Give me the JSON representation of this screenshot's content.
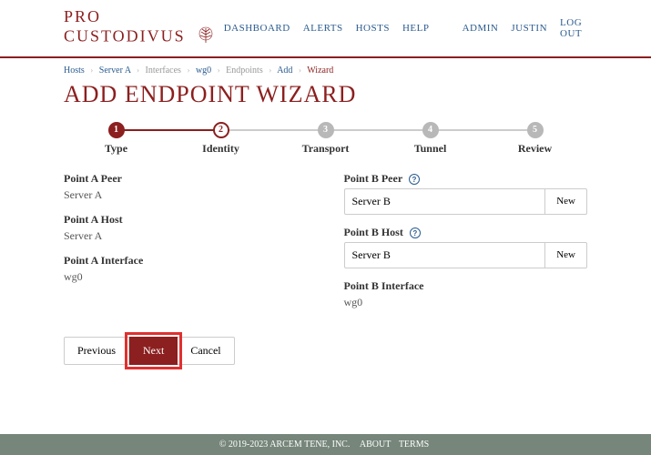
{
  "brand": "PRO CUSTODIVUS",
  "nav": {
    "dashboard": "DASHBOARD",
    "alerts": "ALERTS",
    "hosts": "HOSTS",
    "help": "HELP",
    "admin": "ADMIN",
    "user": "JUSTIN",
    "logout": "LOG OUT"
  },
  "breadcrumbs": {
    "hosts": "Hosts",
    "serverA": "Server A",
    "interfaces": "Interfaces",
    "wg0": "wg0",
    "endpoints": "Endpoints",
    "add": "Add",
    "wizard": "Wizard"
  },
  "title": "ADD ENDPOINT WIZARD",
  "steps": {
    "s1": "Type",
    "s2": "Identity",
    "s3": "Transport",
    "s4": "Tunnel",
    "s5": "Review"
  },
  "left": {
    "peer_label": "Point A Peer",
    "peer_value": "Server A",
    "host_label": "Point A Host",
    "host_value": "Server A",
    "iface_label": "Point A Interface",
    "iface_value": "wg0"
  },
  "right": {
    "peer_label": "Point B Peer",
    "peer_value": "Server B",
    "peer_new": "New",
    "host_label": "Point B Host",
    "host_value": "Server B",
    "host_new": "New",
    "iface_label": "Point B Interface",
    "iface_value": "wg0"
  },
  "buttons": {
    "previous": "Previous",
    "next": "Next",
    "cancel": "Cancel"
  },
  "footer": {
    "copyright": "© 2019-2023 ARCEM TENE, INC.",
    "about": "ABOUT",
    "terms": "TERMS"
  }
}
